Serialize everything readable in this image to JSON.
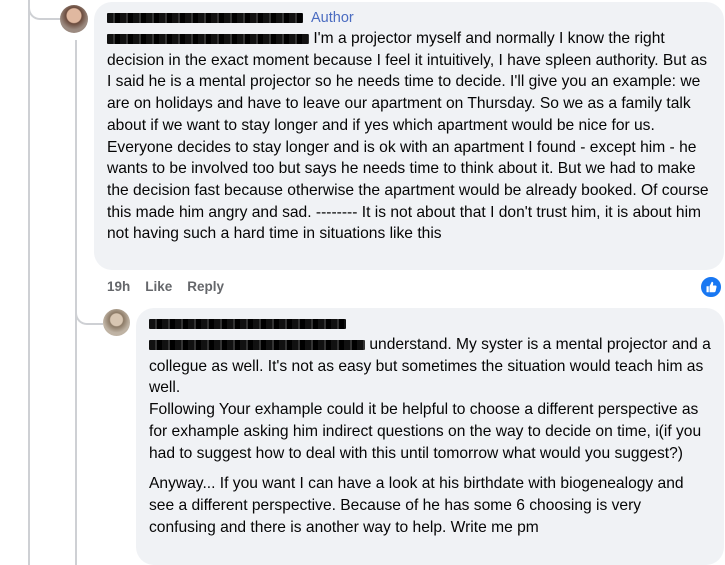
{
  "comment1": {
    "author_badge": "Author",
    "text": "I'm a projector myself and normally I know the right decision in the exact moment because I feel it intuitively, I have spleen authority. But as I said he is a mental projector so he needs time to decide. I'll give you an example: we are on holidays and have to leave our apartment on Thursday. So we as a family talk about if we want to stay longer and if yes which apartment would be nice for us. Everyone decides to stay longer and is ok with an apartment I found - except him - he wants to be involved too but says he needs time to think about it. But we had to make the decision fast because otherwise the apartment would be already booked. Of course this made him angry and sad. -------- It is not about that I don't trust him, it is about him not having such a hard time in situations like this",
    "time": "19h",
    "like_label": "Like",
    "reply_label": "Reply",
    "reaction_icon": "thumbs-up-icon",
    "accent": "#1877f2"
  },
  "comment2": {
    "text_p1": "understand. My syster is a mental projector and a collegue as well. It's not as easy but sometimes the situation would teach him as well.",
    "text_p2": "Following Your exhample could it be helpful to choose a different perspective as for exhample asking him indirect questions on the way to decide on time, i(if you had to suggest how to deal with this until tomorrow what would you suggest?)",
    "text_p3": "Anyway... If you want I can have a look at his birthdate with biogenealogy and see a different perspective. Because of he has some 6 choosing is very confusing and there is another way to help. Write me pm"
  }
}
